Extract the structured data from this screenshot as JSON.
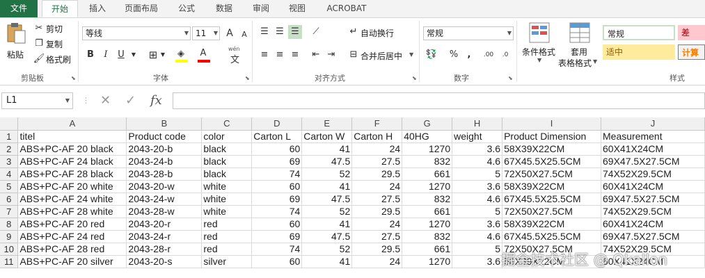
{
  "ribbon_tabs": [
    "文件",
    "开始",
    "插入",
    "页面布局",
    "公式",
    "数据",
    "审阅",
    "视图",
    "ACROBAT"
  ],
  "clipboard": {
    "paste": "粘贴",
    "cut": "剪切",
    "copy": "复制",
    "format_painter": "格式刷",
    "label": "剪贴板"
  },
  "font": {
    "name": "等线",
    "size": "11",
    "increase": "A",
    "decrease": "A",
    "bold": "B",
    "italic": "I",
    "underline": "U",
    "wen": "wén",
    "wen2": "文",
    "label": "字体"
  },
  "alignment": {
    "wrap": "自动换行",
    "merge": "合并后居中",
    "label": "对齐方式"
  },
  "number": {
    "format": "常规",
    "percent": "%",
    "comma": ",",
    "label": "数字"
  },
  "styles": {
    "conditional": "条件格式",
    "table_line1": "套用",
    "table_line2": "表格格式",
    "normal": "常规",
    "bad": "差",
    "neutral": "适中",
    "calc": "计算",
    "label": "样式"
  },
  "formula_bar": {
    "name_box": "L1",
    "fx": "fx",
    "cancel": "✕",
    "enter": "✓"
  },
  "columns": [
    "A",
    "B",
    "C",
    "D",
    "E",
    "F",
    "G",
    "H",
    "I",
    "J"
  ],
  "rows": [
    {
      "n": "1",
      "c": [
        "titel",
        "Product code",
        "color",
        "Carton L",
        "Carton W",
        "Carton H",
        "40HG",
        "weight",
        "Product Dimension",
        "Measurement"
      ]
    },
    {
      "n": "2",
      "c": [
        "ABS+PC-AF 20 black",
        "2043-20-b",
        "black",
        "60",
        "41",
        "24",
        "1270",
        "3.6",
        "58X39X22CM",
        "60X41X24CM"
      ]
    },
    {
      "n": "3",
      "c": [
        "ABS+PC-AF 24 black",
        "2043-24-b",
        "black",
        "69",
        "47.5",
        "27.5",
        "832",
        "4.6",
        "67X45.5X25.5CM",
        "69X47.5X27.5CM"
      ]
    },
    {
      "n": "4",
      "c": [
        "ABS+PC-AF 28 black",
        "2043-28-b",
        "black",
        "74",
        "52",
        "29.5",
        "661",
        "5",
        "72X50X27.5CM",
        "74X52X29.5CM"
      ]
    },
    {
      "n": "5",
      "c": [
        "ABS+PC-AF 20 white",
        "2043-20-w",
        "white",
        "60",
        "41",
        "24",
        "1270",
        "3.6",
        "58X39X22CM",
        "60X41X24CM"
      ]
    },
    {
      "n": "6",
      "c": [
        "ABS+PC-AF 24 white",
        "2043-24-w",
        "white",
        "69",
        "47.5",
        "27.5",
        "832",
        "4.6",
        "67X45.5X25.5CM",
        "69X47.5X27.5CM"
      ]
    },
    {
      "n": "7",
      "c": [
        "ABS+PC-AF 28 white",
        "2043-28-w",
        "white",
        "74",
        "52",
        "29.5",
        "661",
        "5",
        "72X50X27.5CM",
        "74X52X29.5CM"
      ]
    },
    {
      "n": "8",
      "c": [
        "ABS+PC-AF 20 red",
        "2043-20-r",
        "red",
        "60",
        "41",
        "24",
        "1270",
        "3.6",
        "58X39X22CM",
        "60X41X24CM"
      ]
    },
    {
      "n": "9",
      "c": [
        "ABS+PC-AF 24 red",
        "2043-24-r",
        "red",
        "69",
        "47.5",
        "27.5",
        "832",
        "4.6",
        "67X45.5X25.5CM",
        "69X47.5X27.5CM"
      ]
    },
    {
      "n": "10",
      "c": [
        "ABS+PC-AF 28 red",
        "2043-28-r",
        "red",
        "74",
        "52",
        "29.5",
        "661",
        "5",
        "72X50X27.5CM",
        "74X52X29.5CM"
      ]
    },
    {
      "n": "11",
      "c": [
        "ABS+PC-AF 20 silver",
        "2043-20-s",
        "silver",
        "60",
        "41",
        "24",
        "1270",
        "3.6",
        "58X39X22CM",
        "60X41X24CM"
      ]
    }
  ],
  "watermark": "掘金技术社区 @ Qkallon",
  "colors": {
    "excel_green": "#217346",
    "style_normal": "#ffffff",
    "style_bad_bg": "#ffc7ce",
    "style_bad_fg": "#9c0006",
    "style_neutral_bg": "#ffeb9c",
    "style_neutral_fg": "#9c5700",
    "style_calc_bg": "#f2f2f2",
    "style_calc_fg": "#fa7d00"
  }
}
